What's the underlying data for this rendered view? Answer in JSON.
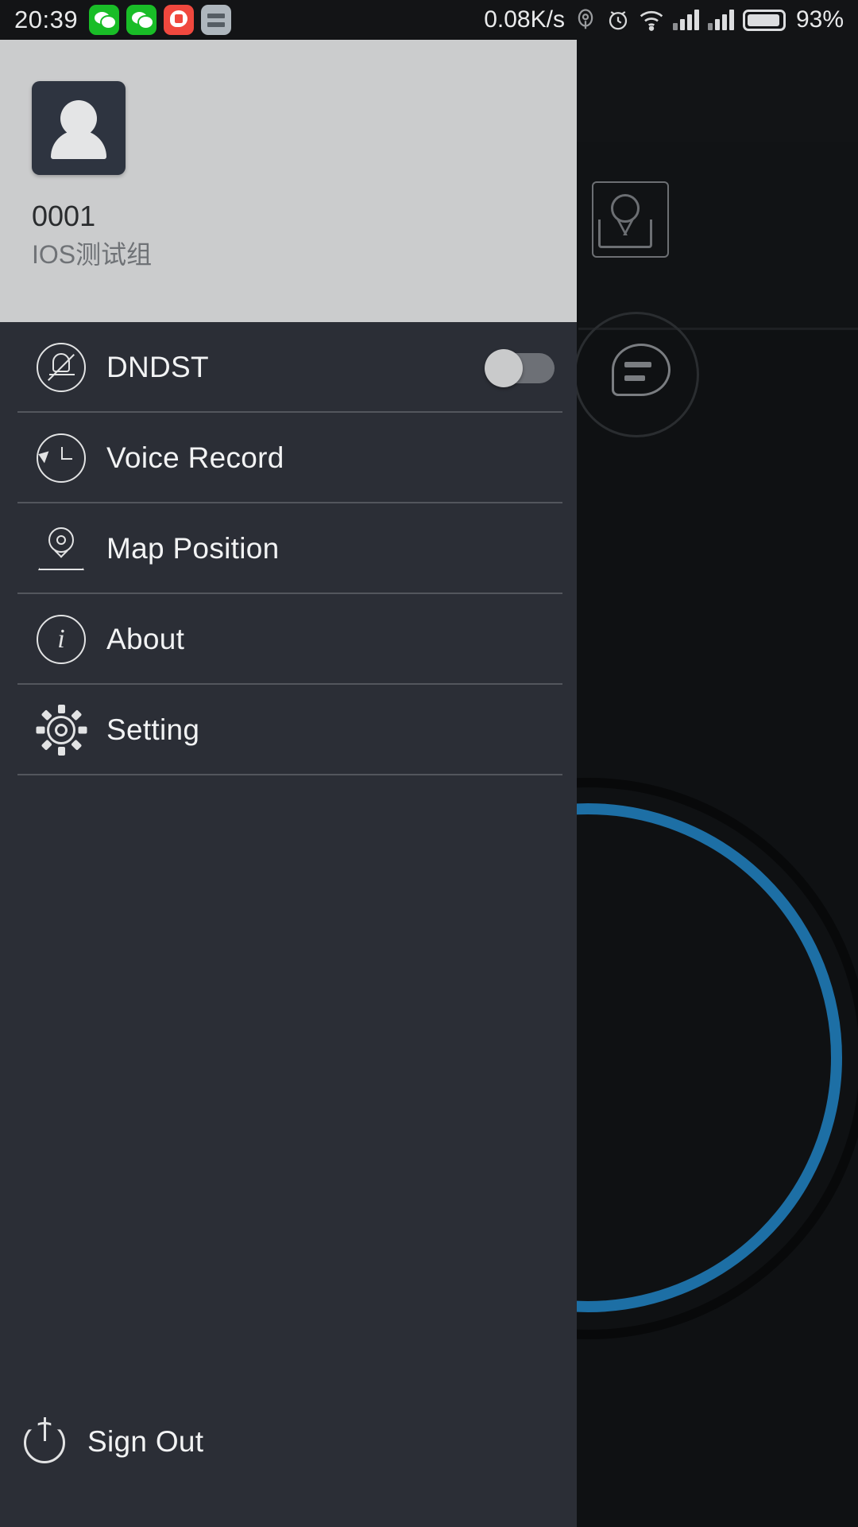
{
  "statusbar": {
    "time": "20:39",
    "network_speed": "0.08K/s",
    "battery_percent": "93%",
    "app_icons": [
      "wechat-icon",
      "wechat-icon",
      "red-chat-icon",
      "document-icon"
    ],
    "indicator_icons": [
      "location-icon",
      "alarm-icon",
      "wifi-icon",
      "signal-icon",
      "signal-icon",
      "battery-icon"
    ]
  },
  "drawer": {
    "profile": {
      "avatar_icon": "person-avatar",
      "name": "0001",
      "group": "IOS测试组"
    },
    "menu": [
      {
        "label": "DNDST",
        "icon": "bell-off-icon",
        "has_toggle": true,
        "toggle_on": false
      },
      {
        "label": "Voice Record",
        "icon": "history-clock-icon",
        "has_toggle": false
      },
      {
        "label": "Map Position",
        "icon": "map-pin-icon",
        "has_toggle": false
      },
      {
        "label": "About",
        "icon": "info-icon",
        "has_toggle": false
      },
      {
        "label": "Setting",
        "icon": "gear-icon",
        "has_toggle": false
      }
    ],
    "signout": {
      "label": "Sign Out",
      "icon": "power-icon"
    }
  },
  "background": {
    "contact_avatar_icon": "person-outline-icon",
    "chat_icon": "chat-bubble-icon",
    "ptt_ring_color": "#1d6fa5"
  },
  "colors": {
    "drawer_bg": "#2b2e36",
    "profile_bg": "#cbcccd",
    "accent": "#1d6fa5",
    "text_light": "#f2f3f4"
  }
}
